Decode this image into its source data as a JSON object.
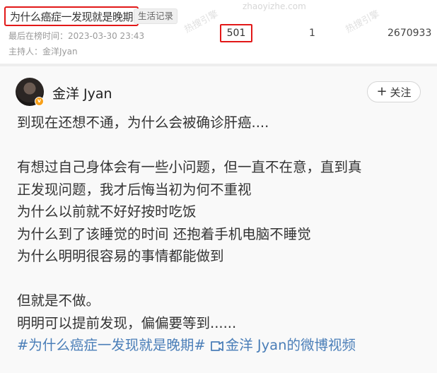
{
  "result_row": {
    "title": "为什么癌症一发现就是晚期",
    "tag": "生活记录",
    "last_on_list": "最后在榜时间：2023-03-30 23:43",
    "host": "主持人：金洋Jyan",
    "count": "501",
    "rank": "1",
    "heat": "2670933",
    "watermarks": [
      "热搜引擎",
      "zhaoyizhe.com",
      "热搜引擎"
    ]
  },
  "post": {
    "username": "金洋 Jyan",
    "follow_label": "关注",
    "lines": [
      "到现在还想不通，为什么会被确诊肝癌....",
      "",
      "有想过自己身体会有一些小问题，但一直不在意，直到真",
      "正发现问题，我才后悔当初为何不重视",
      "为什么以前就不好好按时吃饭",
      "为什么到了该睡觉的时间 还抱着手机电脑不睡觉",
      "为什么明明很容易的事情都能做到",
      "",
      "但就是不做。",
      "明明可以提前发现，偏偏要等到......"
    ],
    "hashtag": "#为什么癌症一发现就是晚期#",
    "video_link": "金洋 Jyan的微博视频"
  },
  "icons": {
    "follow": "plus-icon",
    "video": "video-icon",
    "verified": "verified-badge-icon"
  },
  "colors": {
    "highlight_border": "#e21818",
    "link": "#4a7eb8",
    "badge": "#f7a01a"
  }
}
